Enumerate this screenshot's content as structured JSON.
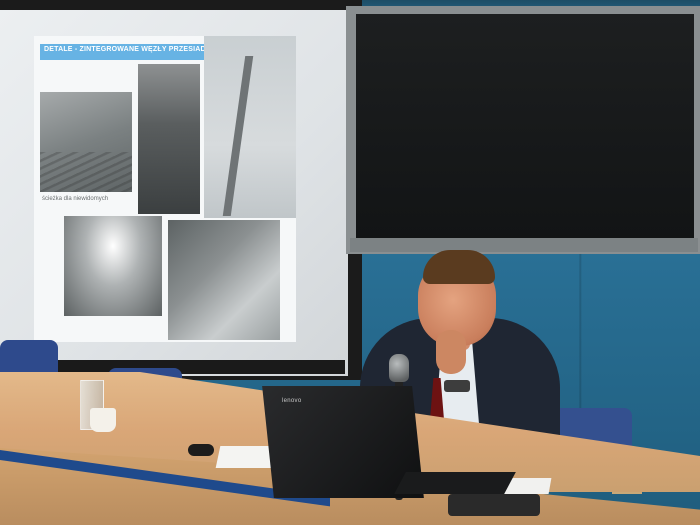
{
  "slide": {
    "title": "DETALE - ZINTEGROWANE WĘZŁY PRZESIADKOWE",
    "caption": "ścieżka dla niewidomych"
  },
  "laptop": {
    "brand_text": "lenovo"
  }
}
